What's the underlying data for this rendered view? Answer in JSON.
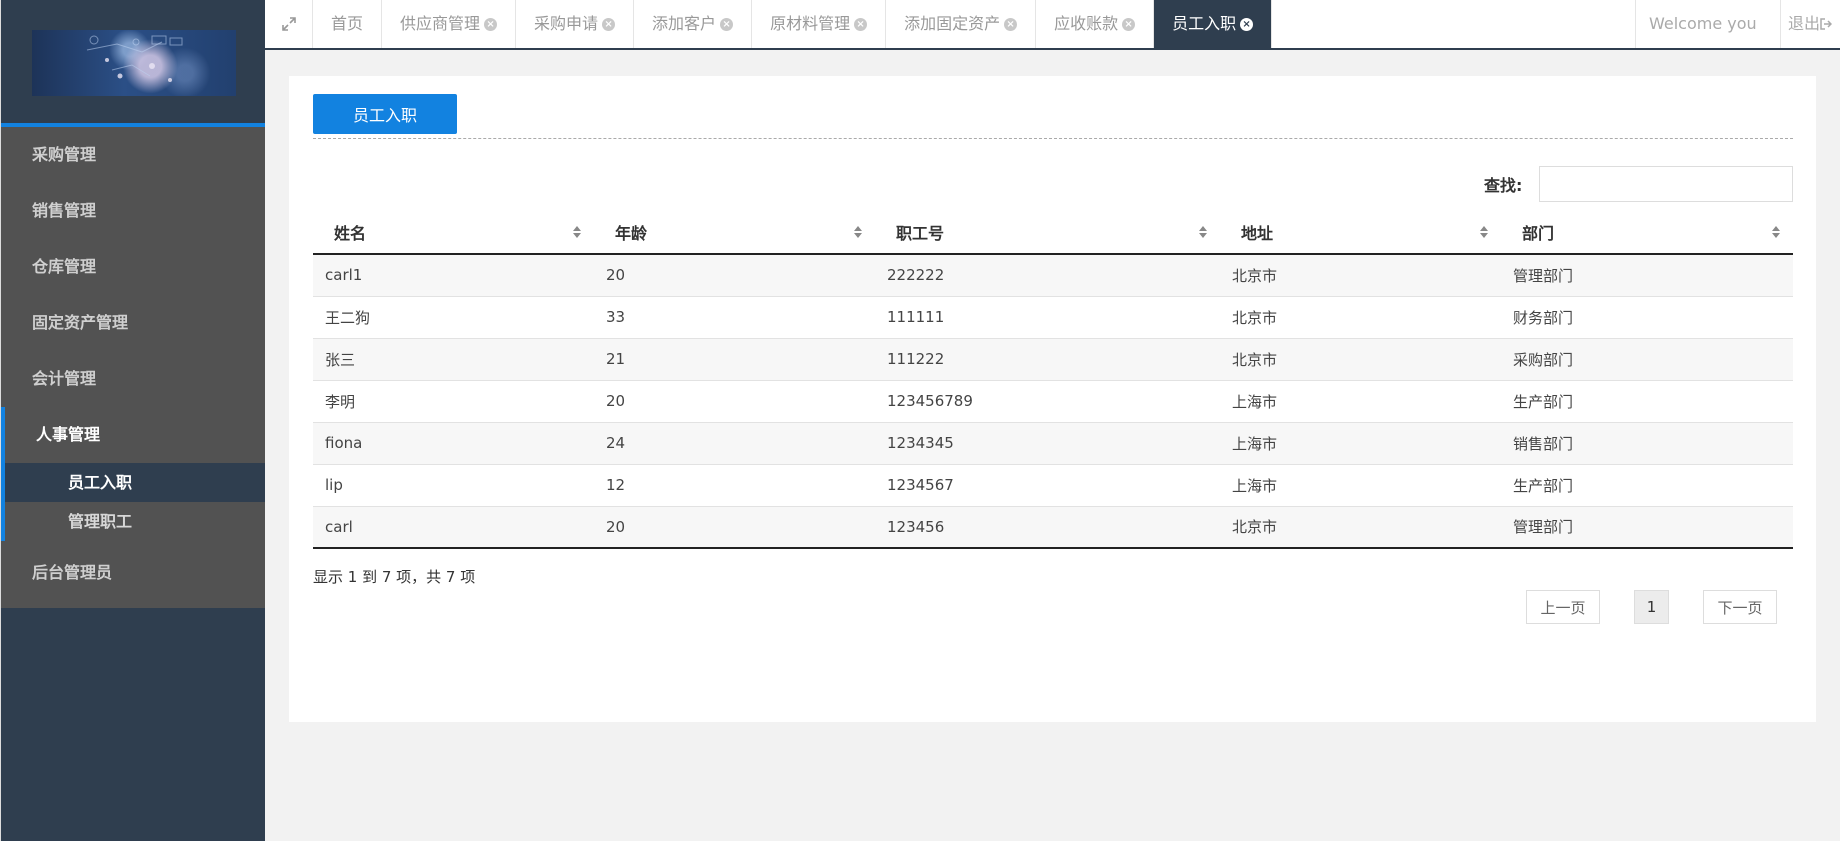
{
  "sidebar": {
    "menu": [
      {
        "label": "采购管理"
      },
      {
        "label": "销售管理"
      },
      {
        "label": "仓库管理"
      },
      {
        "label": "固定资产管理"
      },
      {
        "label": "会计管理"
      },
      {
        "label": "人事管理"
      }
    ],
    "submenu": [
      {
        "label": "员工入职"
      },
      {
        "label": "管理职工"
      }
    ],
    "last_menu": {
      "label": "后台管理员"
    }
  },
  "tabs": [
    {
      "label": "首页"
    },
    {
      "label": "供应商管理"
    },
    {
      "label": "采购申请"
    },
    {
      "label": "添加客户"
    },
    {
      "label": "原材料管理"
    },
    {
      "label": "添加固定资产"
    },
    {
      "label": "应收账款"
    },
    {
      "label": "员工入职"
    }
  ],
  "header": {
    "welcome": "Welcome you",
    "logout": "退出"
  },
  "main": {
    "add_button": "员工入职",
    "search_label": "查找:",
    "search_value": "",
    "table": {
      "columns": [
        "姓名",
        "年龄",
        "职工号",
        "地址",
        "部门"
      ],
      "rows": [
        [
          "carl1",
          "20",
          "222222",
          "北京市",
          "管理部门"
        ],
        [
          "王二狗",
          "33",
          "111111",
          "北京市",
          "财务部门"
        ],
        [
          "张三",
          "21",
          "111222",
          "北京市",
          "采购部门"
        ],
        [
          "李明",
          "20",
          "123456789",
          "上海市",
          "生产部门"
        ],
        [
          "fiona",
          "24",
          "1234345",
          "上海市",
          "销售部门"
        ],
        [
          "lip",
          "12",
          "1234567",
          "上海市",
          "生产部门"
        ],
        [
          "carl",
          "20",
          "123456",
          "北京市",
          "管理部门"
        ]
      ]
    },
    "info": "显示 1 到 7 项，共 7 项",
    "pagination": {
      "prev": "上一页",
      "page": "1",
      "next": "下一页"
    }
  },
  "colors": {
    "sidebar_bg": "#2f3e4f",
    "menu_bg": "#525252",
    "accent": "#1282e0"
  }
}
